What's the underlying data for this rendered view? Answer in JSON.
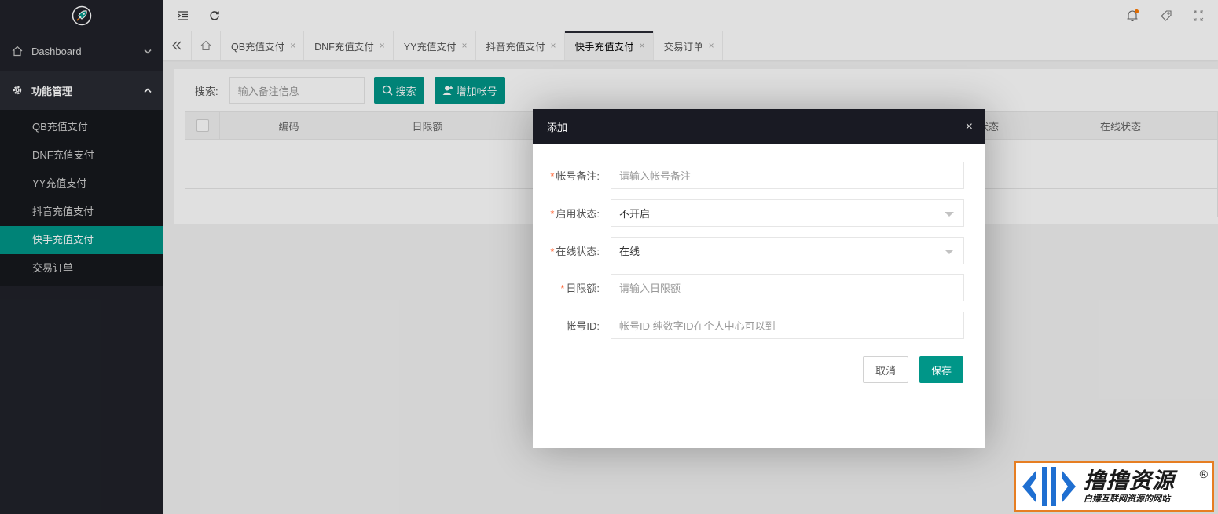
{
  "sidebar": {
    "groups": [
      {
        "label": "Dashboard"
      },
      {
        "label": "功能管理"
      }
    ],
    "items": [
      {
        "label": "QB充值支付"
      },
      {
        "label": "DNF充值支付"
      },
      {
        "label": "YY充值支付"
      },
      {
        "label": "抖音充值支付"
      },
      {
        "label": "快手充值支付"
      },
      {
        "label": "交易订单"
      }
    ],
    "active_item": "快手充值支付"
  },
  "tabs": [
    {
      "label": "QB充值支付"
    },
    {
      "label": "DNF充值支付"
    },
    {
      "label": "YY充值支付"
    },
    {
      "label": "抖音充值支付"
    },
    {
      "label": "快手充值支付"
    },
    {
      "label": "交易订单"
    }
  ],
  "tab_close": "×",
  "search": {
    "label": "搜索:",
    "placeholder": "输入备注信息",
    "search_button": "搜索",
    "add_button": "增加帐号"
  },
  "table": {
    "columns": [
      "编码",
      "日限额",
      "状态",
      "在线状态"
    ]
  },
  "modal": {
    "title": "添加",
    "close": "×",
    "fields": [
      {
        "label": "帐号备注:",
        "required": true,
        "placeholder": "请输入帐号备注"
      },
      {
        "label": "启用状态:",
        "required": true,
        "value": "不开启"
      },
      {
        "label": "在线状态:",
        "required": true,
        "value": "在线"
      },
      {
        "label": "日限额:",
        "required": true,
        "placeholder": "请输入日限额"
      },
      {
        "label": "帐号ID:",
        "required": false,
        "placeholder": "帐号ID 纯数字ID在个人中心可以到"
      }
    ],
    "cancel": "取消",
    "save": "保存",
    "required_mark": "*"
  },
  "watermark": {
    "title": "撸撸资源",
    "subtitle": "白嫖互联网资源的网站",
    "reg": "®"
  },
  "colors": {
    "accent": "#009688",
    "sidebar_bg": "#20222a",
    "modal_header": "#191a23",
    "badge": "#ff7a00"
  },
  "icons": {
    "logo": "rocket-logo-icon",
    "menu": "menu-fold-icon",
    "refresh": "refresh-icon",
    "notify": "bell-icon",
    "theme": "tag-icon",
    "fullscreen": "fullscreen-icon",
    "home": "home-icon"
  }
}
